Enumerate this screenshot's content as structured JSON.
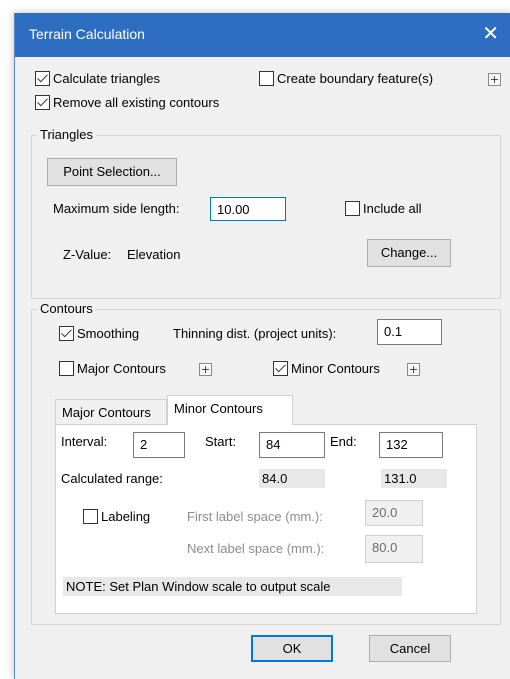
{
  "window": {
    "title": "Terrain Calculation",
    "close": "✕"
  },
  "options": {
    "calculate_triangles": "Calculate triangles",
    "create_boundary": "Create boundary feature(s)",
    "remove_contours": "Remove all existing contours",
    "plus": "+"
  },
  "triangles": {
    "group_label": "Triangles",
    "point_selection": "Point Selection...",
    "max_side_label": "Maximum side length:",
    "max_side_value": "10.00",
    "include_all": "Include all",
    "zvalue_label": "Z-Value:",
    "zvalue_value": "Elevation",
    "change": "Change..."
  },
  "contours": {
    "group_label": "Contours",
    "smoothing": "Smoothing",
    "thinning_label": "Thinning dist. (project units):",
    "thinning_value": "0.1",
    "major": "Major Contours",
    "minor": "Minor Contours",
    "tabs": [
      "Major Contours",
      "Minor Contours"
    ],
    "interval_label": "Interval:",
    "interval_value": "2",
    "start_label": "Start:",
    "start_value": "84",
    "end_label": "End:",
    "end_value": "132",
    "calc_range_label": "Calculated range:",
    "calc_range_start": "84.0",
    "calc_range_end": "131.0",
    "labeling": "Labeling",
    "first_label_space": "First label space (mm.):",
    "first_label_value": "20.0",
    "next_label_space": "Next label space (mm.):",
    "next_label_value": "80.0",
    "note": "NOTE: Set Plan Window scale to output scale"
  },
  "buttons": {
    "ok": "OK",
    "cancel": "Cancel"
  }
}
